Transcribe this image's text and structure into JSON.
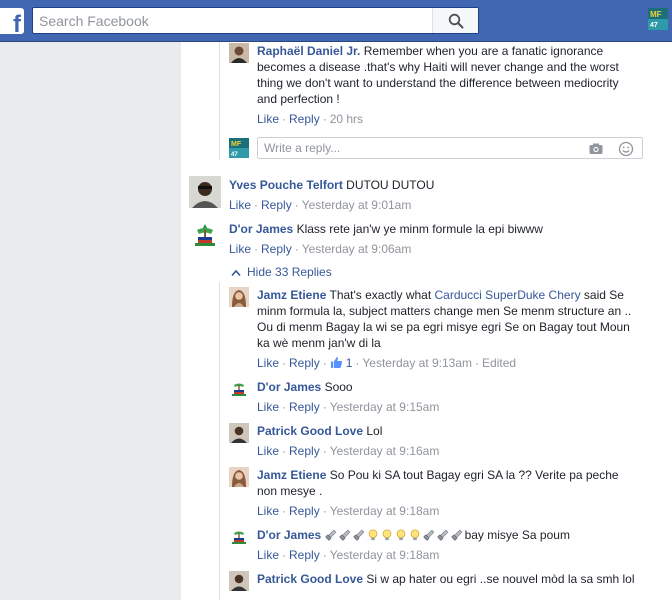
{
  "header": {
    "search_placeholder": "Search Facebook",
    "logo_letter": "f"
  },
  "comments": [
    {
      "name": "Raphaël Daniel Jr.",
      "text": "Remember when you are a fanatic ignorance becomes a disease .that's why Haiti will never change and the worst thing we don't want to understand the difference between mediocrity and perfection !",
      "like": "Like",
      "reply": "Reply",
      "time": "20 hrs"
    },
    {
      "name": "Yves Pouche Telfort",
      "text": "DUTOU DUTOU",
      "like": "Like",
      "reply": "Reply",
      "time": "Yesterday at 9:01am"
    },
    {
      "name": "D'or James",
      "text": "Klass rete jan'w ye minm formule la epi biwww",
      "like": "Like",
      "reply": "Reply",
      "time": "Yesterday at 9:06am"
    },
    {
      "name": "Jamz Etiene",
      "text_before": "That's exactly what ",
      "mention": "Carducci SuperDuke Chery",
      "text_after": " said Se minm formula la, subject matters change men Se menm structure an .. Ou di menm Bagay la wi se pa egri misye egri Se on Bagay tout Moun ka wè menm jan'w di la",
      "like": "Like",
      "reply": "Reply",
      "like_count": "1",
      "time": "Yesterday at 9:13am",
      "edited": "Edited"
    },
    {
      "name": "D'or James",
      "text": "Sooo",
      "like": "Like",
      "reply": "Reply",
      "time": "Yesterday at 9:15am"
    },
    {
      "name": "Patrick Good Love",
      "text": "Lol",
      "like": "Like",
      "reply": "Reply",
      "time": "Yesterday at 9:16am"
    },
    {
      "name": "Jamz Etiene",
      "text": "So Pou ki SA tout Bagay egri SA la ?? Verite pa peche non mesye .",
      "like": "Like",
      "reply": "Reply",
      "time": "Yesterday at 9:18am"
    },
    {
      "name": "D'or James",
      "emojis": [
        "flashlight",
        "flashlight",
        "flashlight",
        "bulb",
        "bulb",
        "bulb",
        "bulb",
        "flashlight",
        "flashlight",
        "flashlight"
      ],
      "text": "bay misye Sa poum",
      "like": "Like",
      "reply": "Reply",
      "time": "Yesterday at 9:18am"
    },
    {
      "name": "Patrick Good Love",
      "text": "Si w ap hater ou egri ..se nouvel mòd la sa smh lol"
    }
  ],
  "reply_box": {
    "placeholder": "Write a reply..."
  },
  "hide_replies": "Hide 33 Replies",
  "colors": {
    "topbar": "#4267b2",
    "link": "#365899",
    "meta": "#90949c",
    "sidebar": "#e9ebee"
  }
}
